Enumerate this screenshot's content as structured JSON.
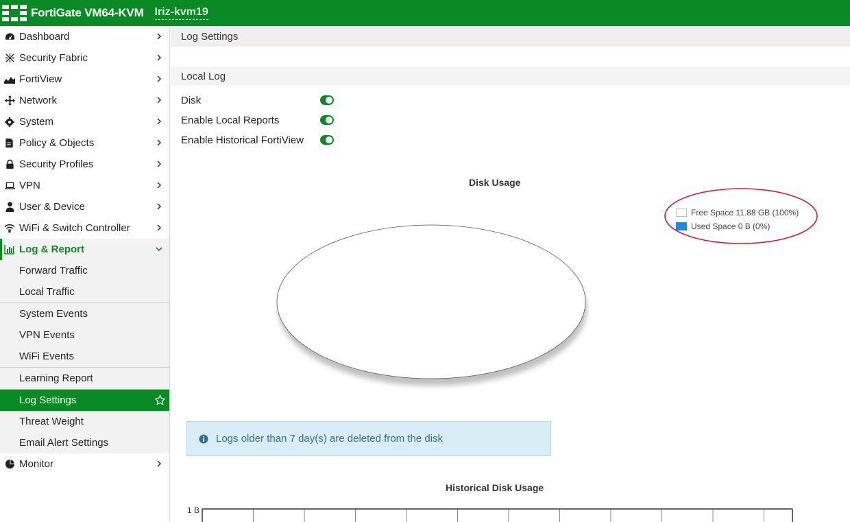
{
  "topbar": {
    "product": "FortiGate VM64-KVM",
    "hostname": "Iriz-kvm19"
  },
  "sidebar": {
    "items": [
      {
        "label": "Dashboard",
        "icon": "dashboard-icon"
      },
      {
        "label": "Security Fabric",
        "icon": "security-fabric-icon"
      },
      {
        "label": "FortiView",
        "icon": "fortiview-icon"
      },
      {
        "label": "Network",
        "icon": "network-icon"
      },
      {
        "label": "System",
        "icon": "gear-icon"
      },
      {
        "label": "Policy & Objects",
        "icon": "policy-icon"
      },
      {
        "label": "Security Profiles",
        "icon": "lock-icon"
      },
      {
        "label": "VPN",
        "icon": "laptop-icon"
      },
      {
        "label": "User & Device",
        "icon": "user-icon"
      },
      {
        "label": "WiFi & Switch Controller",
        "icon": "wifi-icon"
      }
    ],
    "log_report": {
      "label": "Log & Report",
      "icon": "bar-chart-icon",
      "sub": [
        "Forward Traffic",
        "Local Traffic",
        "System Events",
        "VPN Events",
        "WiFi Events",
        "Learning Report",
        "Log Settings",
        "Threat Weight",
        "Email Alert Settings"
      ],
      "selected": "Log Settings"
    },
    "monitor": {
      "label": "Monitor",
      "icon": "pie-chart-icon"
    }
  },
  "main": {
    "header": "Log Settings",
    "section": "Local Log",
    "toggles": [
      {
        "label": "Disk",
        "on": true
      },
      {
        "label": "Enable Local Reports",
        "on": true
      },
      {
        "label": "Enable Historical FortiView",
        "on": true
      }
    ],
    "info_text": "Logs older than 7 day(s) are deleted from the disk"
  },
  "chart_data": [
    {
      "type": "pie",
      "title": "Disk Usage",
      "slices": [
        {
          "label": "Free Space 11.88 GB (100%)",
          "value": 100,
          "color": "#ffffff"
        },
        {
          "label": "Used Space 0 B (0%)",
          "value": 0,
          "color": "#1e88e5"
        }
      ],
      "legend": "top-right"
    },
    {
      "type": "line",
      "title": "Historical Disk Usage",
      "ytick_top": "1 B",
      "grid": true
    }
  ],
  "colors": {
    "brand": "#0a8a24",
    "annotation": "#cc2233"
  }
}
